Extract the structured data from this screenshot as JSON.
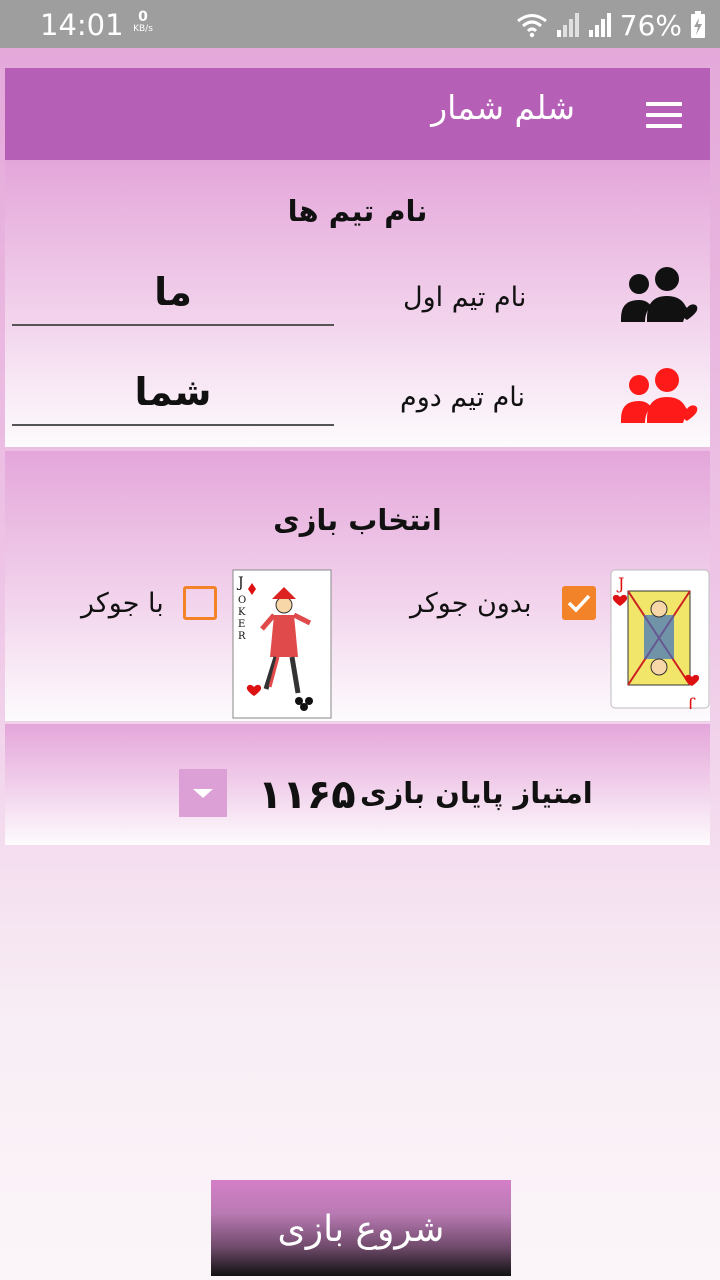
{
  "status_bar": {
    "time": "14:01",
    "net_speed_value": "0",
    "net_speed_unit": "KB/s",
    "battery": "76%",
    "icons": [
      "wifi-icon",
      "signal-icon",
      "signal-icon",
      "battery-charging-icon"
    ]
  },
  "toolbar": {
    "title": "شلم شمار",
    "menu_icon": "menu-icon"
  },
  "teams": {
    "title": "نام تیم ها",
    "team1": {
      "label": "نام تیم اول",
      "value": "ما",
      "icon": "team-heart-icon",
      "icon_color": "#111111"
    },
    "team2": {
      "label": "نام تیم دوم",
      "value": "شما",
      "icon": "team-heart-icon",
      "icon_color": "#ff1a1a"
    }
  },
  "game_select": {
    "title": "انتخاب بازی",
    "options": [
      {
        "label": "بدون جوکر",
        "checked": true,
        "card": "jack-of-hearts-card"
      },
      {
        "label": "با جوکر",
        "checked": false,
        "card": "joker-card"
      }
    ],
    "accent_color": "#f38328"
  },
  "score": {
    "label": "امتیاز پایان بازی",
    "value": "۱۱۶۵"
  },
  "start_button": {
    "label": "شروع بازی"
  }
}
